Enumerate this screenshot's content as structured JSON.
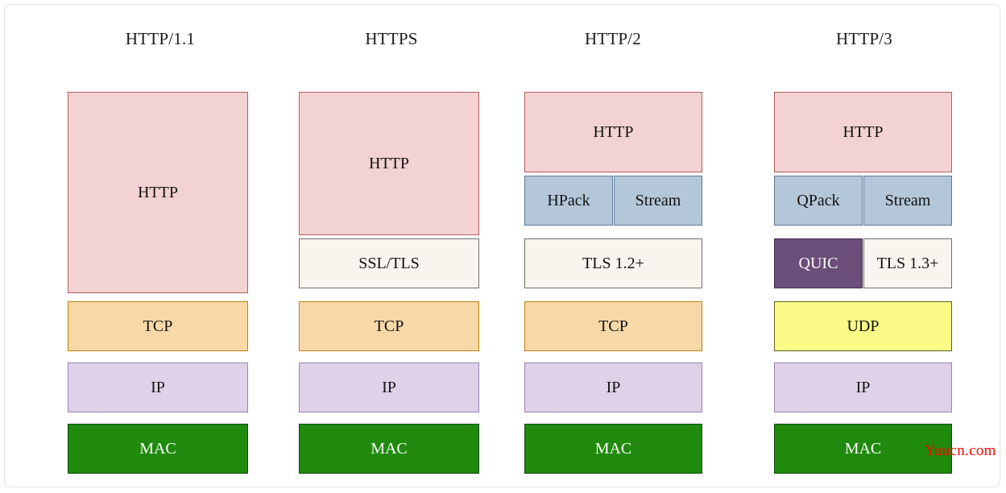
{
  "diagram": {
    "title_row": [
      {
        "label": "HTTP/1.1"
      },
      {
        "label": "HTTPS"
      },
      {
        "label": "HTTP/2"
      },
      {
        "label": "HTTP/3"
      }
    ],
    "watermark": "Yuucn.com",
    "colors": {
      "http_fill": "#f2d2d2",
      "http_side": "#ddb8b8",
      "http_stroke": "#b45b5b",
      "tls_fill": "#f8f5ee",
      "tls_side": "#e0ddd4",
      "tls_stroke": "#6e6e6e",
      "blue_fill": "#b4c7d9",
      "blue_side": "#9fb2c4",
      "blue_stroke": "#5d7894",
      "quic_fill": "#6b4f7a",
      "quic_side": "#5b4268",
      "quic_stroke": "#3f2b4c",
      "tcp_fill": "#f7d9a8",
      "tcp_side": "#e2bd87",
      "tcp_stroke": "#c07f10",
      "udp_fill": "#fbfb88",
      "udp_side": "#e4e46e",
      "udp_stroke": "#5c5c1a",
      "ip_fill": "#ded1e8",
      "ip_side": "#c9bad6",
      "ip_stroke": "#9a82b5",
      "mac_fill": "#1f8a0b",
      "mac_side": "#15690a",
      "mac_stroke": "#0d4a07",
      "watermark": "#ff0000"
    },
    "columns": [
      {
        "name": "HTTP/1.1",
        "blocks": [
          {
            "id": "http",
            "label": "HTTP",
            "palette": "http"
          },
          {
            "id": "tcp",
            "label": "TCP",
            "palette": "tcp"
          },
          {
            "id": "ip",
            "label": "IP",
            "palette": "ip"
          },
          {
            "id": "mac",
            "label": "MAC",
            "palette": "mac"
          }
        ]
      },
      {
        "name": "HTTPS",
        "blocks": [
          {
            "id": "http",
            "label": "HTTP",
            "palette": "http"
          },
          {
            "id": "ssl_tls",
            "label": "SSL/TLS",
            "palette": "tls"
          },
          {
            "id": "tcp",
            "label": "TCP",
            "palette": "tcp"
          },
          {
            "id": "ip",
            "label": "IP",
            "palette": "ip"
          },
          {
            "id": "mac",
            "label": "MAC",
            "palette": "mac"
          }
        ]
      },
      {
        "name": "HTTP/2",
        "blocks": [
          {
            "id": "http",
            "label": "HTTP",
            "palette": "http"
          },
          {
            "id": "hpack",
            "label": "HPack",
            "palette": "blue"
          },
          {
            "id": "stream",
            "label": "Stream",
            "palette": "blue"
          },
          {
            "id": "tls12",
            "label": "TLS 1.2+",
            "palette": "tls"
          },
          {
            "id": "tcp",
            "label": "TCP",
            "palette": "tcp"
          },
          {
            "id": "ip",
            "label": "IP",
            "palette": "ip"
          },
          {
            "id": "mac",
            "label": "MAC",
            "palette": "mac"
          }
        ]
      },
      {
        "name": "HTTP/3",
        "blocks": [
          {
            "id": "http",
            "label": "HTTP",
            "palette": "http"
          },
          {
            "id": "qpack",
            "label": "QPack",
            "palette": "blue"
          },
          {
            "id": "stream",
            "label": "Stream",
            "palette": "blue"
          },
          {
            "id": "quic",
            "label": "QUIC",
            "palette": "quic"
          },
          {
            "id": "tls13",
            "label": "TLS 1.3+",
            "palette": "tls"
          },
          {
            "id": "udp",
            "label": "UDP",
            "palette": "udp"
          },
          {
            "id": "ip",
            "label": "IP",
            "palette": "ip"
          },
          {
            "id": "mac",
            "label": "MAC",
            "palette": "mac"
          }
        ]
      }
    ]
  }
}
